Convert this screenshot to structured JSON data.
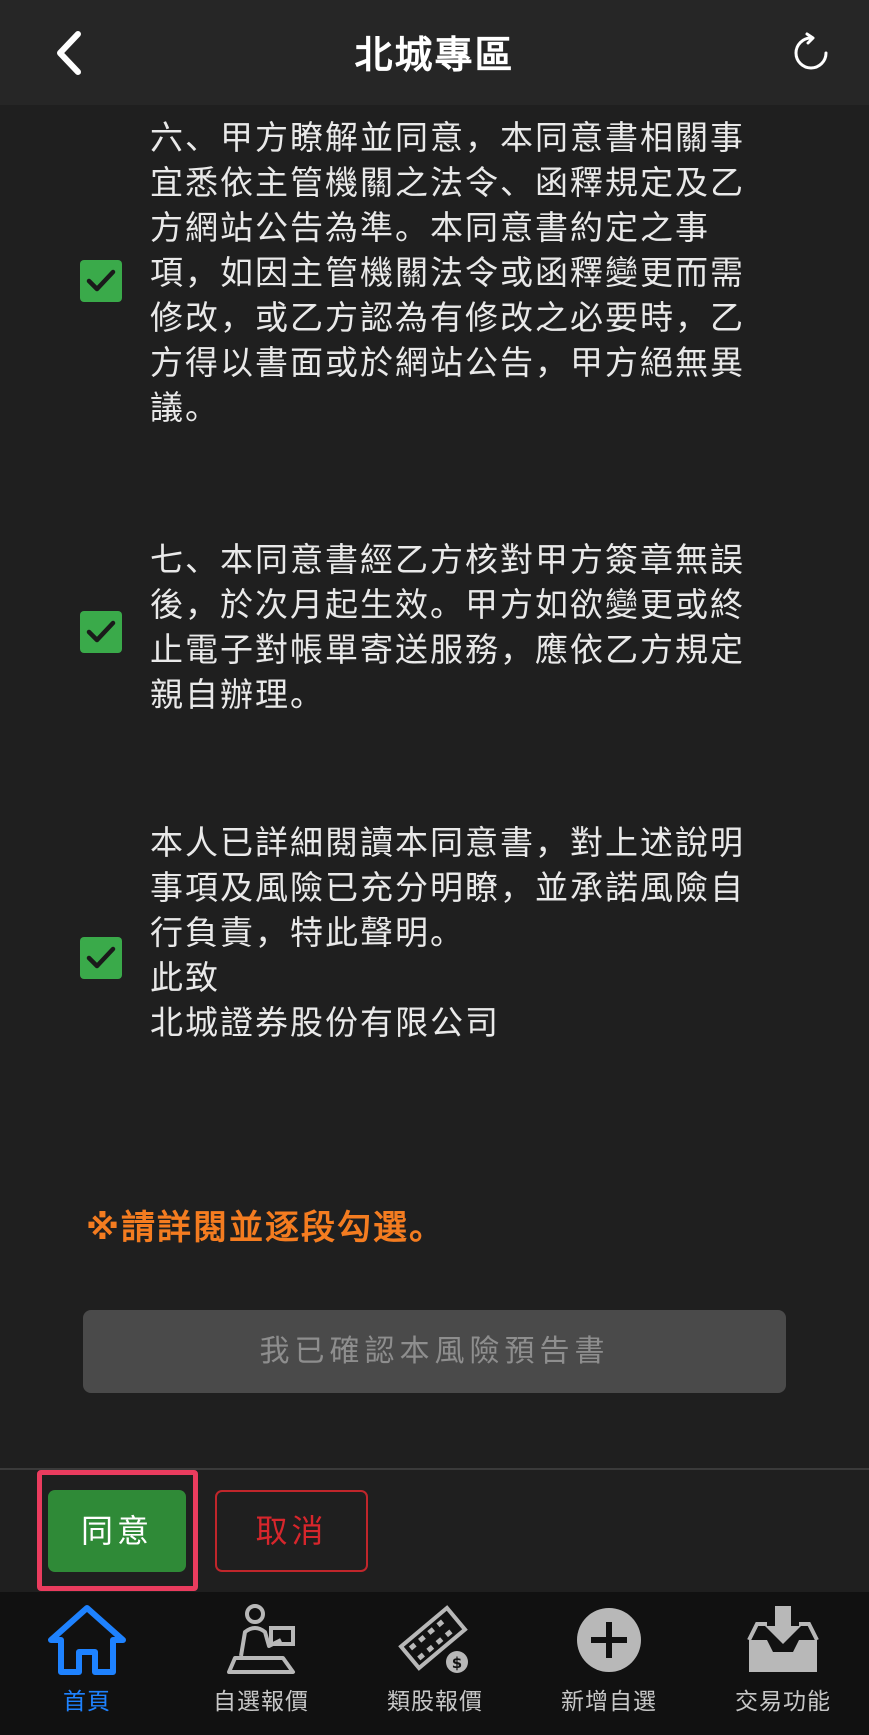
{
  "header": {
    "title": "北城專區",
    "back_icon": "chevron-left-icon",
    "refresh_icon": "refresh-icon"
  },
  "clauses": [
    {
      "text": "六、甲方瞭解並同意，本同意書相關事\n宜悉依主管機關之法令、函釋規定及乙\n方網站公告為準。本同意書約定之事\n項，如因主管機關法令或函釋變更而需\n修改，或乙方認為有修改之必要時，乙\n方得以書面或於網站公告，甲方絕無異\n議。",
      "checked": true
    },
    {
      "text": "七、本同意書經乙方核對甲方簽章無誤\n後，於次月起生效。甲方如欲變更或終\n止電子對帳單寄送服務，應依乙方規定\n親自辦理。",
      "checked": true
    },
    {
      "text": "本人已詳細閱讀本同意書，對上述說明\n事項及風險已充分明瞭，並承諾風險自\n行負責，特此聲明。\n此致\n北城證券股份有限公司",
      "checked": true
    }
  ],
  "notice": "※請詳閱並逐段勾選。",
  "confirm_button": "我已確認本風險預告書",
  "actions": {
    "agree": "同意",
    "cancel": "取消"
  },
  "tabs": [
    {
      "label": "首頁",
      "icon": "home-icon",
      "active": true
    },
    {
      "label": "自選報價",
      "icon": "trader-icon",
      "active": false
    },
    {
      "label": "類股報價",
      "icon": "film-money-icon",
      "active": false
    },
    {
      "label": "新增自選",
      "icon": "add-circle-icon",
      "active": false
    },
    {
      "label": "交易功能",
      "icon": "inbox-download-icon",
      "active": false
    }
  ],
  "colors": {
    "accent_green": "#3aaa4a",
    "notice_orange": "#f47c20",
    "active_tab": "#1e82ff",
    "cancel_red": "#d7262c"
  }
}
